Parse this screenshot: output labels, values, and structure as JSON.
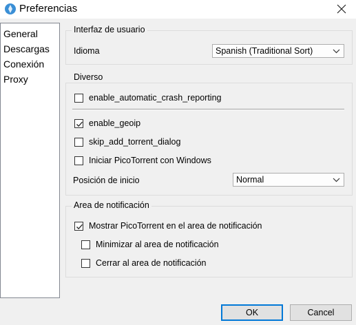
{
  "window": {
    "title": "Preferencias"
  },
  "nav": {
    "items": [
      "General",
      "Descargas",
      "Conexión",
      "Proxy"
    ]
  },
  "ui_group": {
    "legend": "Interfaz de usuario",
    "language_label": "Idioma",
    "language_value": "Spanish (Traditional Sort)"
  },
  "misc_group": {
    "legend": "Diverso",
    "options": [
      {
        "label": "enable_automatic_crash_reporting",
        "checked": false
      },
      {
        "label": "enable_geoip",
        "checked": true
      },
      {
        "label": "skip_add_torrent_dialog",
        "checked": false
      },
      {
        "label": "Iniciar PicoTorrent con Windows",
        "checked": false
      }
    ],
    "start_position_label": "Posición de inicio",
    "start_position_value": "Normal"
  },
  "notify_group": {
    "legend": "Area de notificación",
    "show_in_tray": {
      "label": "Mostrar PicoTorrent en el area de notificación",
      "checked": true
    },
    "minimize_to_tray": {
      "label": "Minimizar al area de notificación",
      "checked": false
    },
    "close_to_tray": {
      "label": "Cerrar al area de notificación",
      "checked": false
    }
  },
  "buttons": {
    "ok": "OK",
    "cancel": "Cancel"
  },
  "colors": {
    "accent": "#0078d7",
    "app_icon": "#3a8fd6"
  }
}
